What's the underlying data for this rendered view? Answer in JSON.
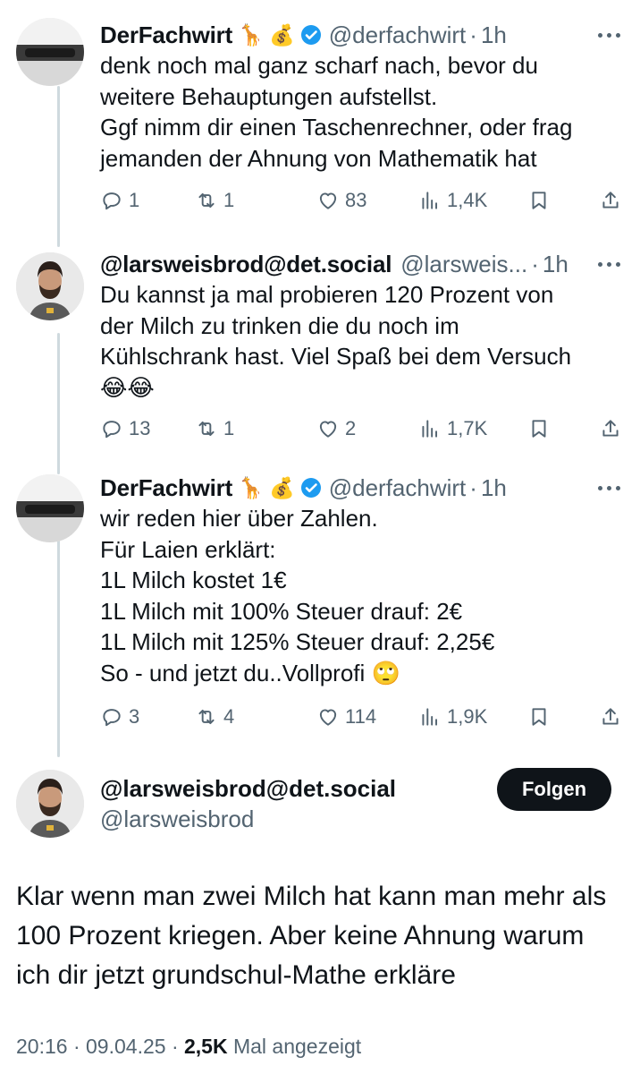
{
  "tweets": [
    {
      "name": "DerFachwirt",
      "emoji": "🦒 💰",
      "handle": "@derfachwirt",
      "time": "1h",
      "lines": [
        "denk noch mal ganz scharf nach, bevor du",
        "weitere Behauptungen aufstellst.",
        "Ggf nimm dir einen Taschenrechner, oder frag",
        "jemanden der Ahnung von Mathematik hat"
      ],
      "replies": "1",
      "retweets": "1",
      "likes": "83",
      "views": "1,4K"
    },
    {
      "name": "@larsweisbrod@det.social",
      "emoji": "",
      "handle": "@larsweis...",
      "time": "1h",
      "lines": [
        "Du kannst ja mal probieren 120 Prozent von",
        "der Milch zu trinken die du noch im",
        "Kühlschrank hast. Viel Spaß bei dem Versuch",
        "😂😂"
      ],
      "replies": "13",
      "retweets": "1",
      "likes": "2",
      "views": "1,7K"
    },
    {
      "name": "DerFachwirt",
      "emoji": "🦒 💰",
      "handle": "@derfachwirt",
      "time": "1h",
      "lines": [
        "wir reden hier über Zahlen.",
        "Für Laien erklärt:",
        "1L Milch kostet 1€",
        "1L Milch mit 100% Steuer drauf: 2€",
        "1L Milch mit 125% Steuer drauf: 2,25€",
        "So - und jetzt du..Vollprofi 🙄"
      ],
      "replies": "3",
      "retweets": "4",
      "likes": "114",
      "views": "1,9K"
    }
  ],
  "main": {
    "name": "@larsweisbrod@det.social",
    "handle": "@larsweisbrod",
    "follow_label": "Folgen",
    "lines": [
      "Klar wenn man zwei Milch hat kann man mehr als",
      "100 Prozent kriegen. Aber keine Ahnung warum",
      "ich dir jetzt grundschul-Mathe erkläre"
    ],
    "time": "20:16",
    "date": "09.04.25",
    "views": "2,5K",
    "views_label": "Mal angezeigt"
  },
  "colors": {
    "text": "#0f1419",
    "secondary": "#536471",
    "verified": "#1d9bf0",
    "thread_line": "#cfd9de"
  }
}
